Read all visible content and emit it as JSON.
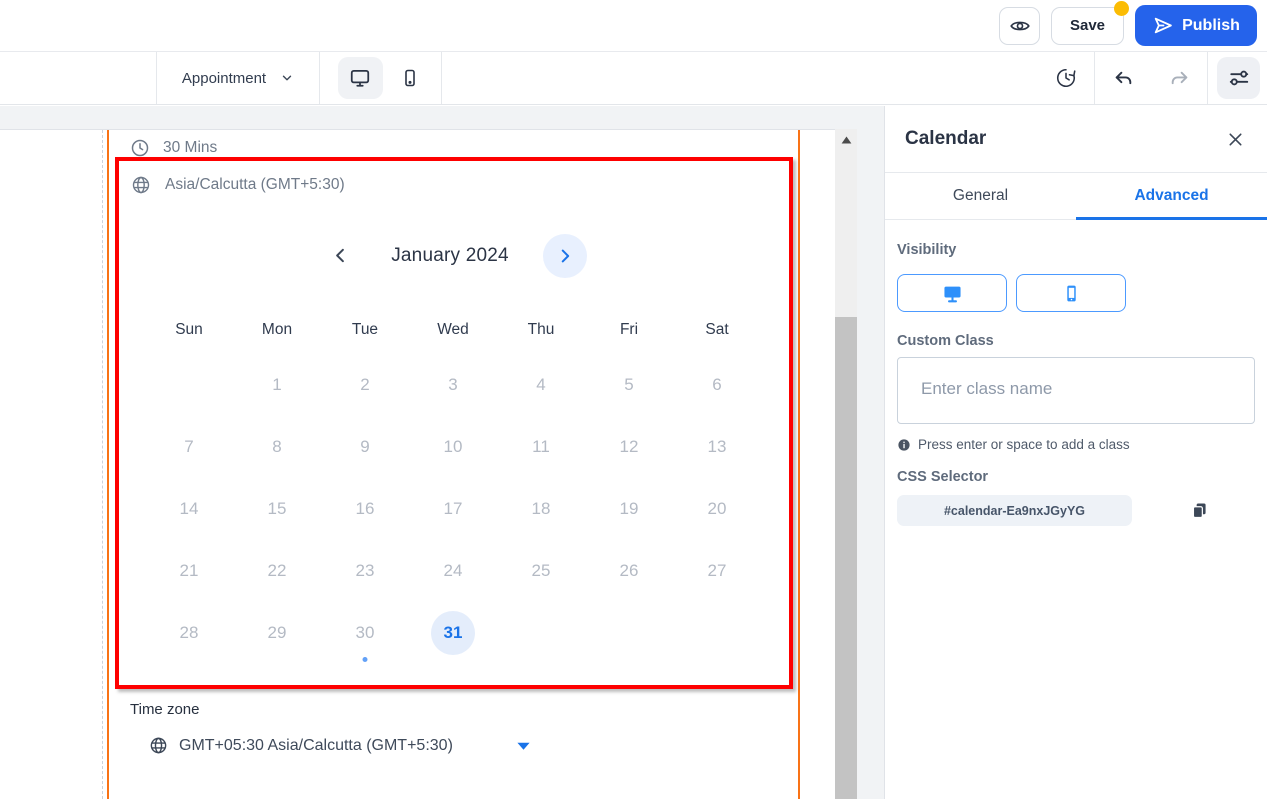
{
  "topbar": {
    "save_label": "Save",
    "publish_label": "Publish"
  },
  "toolbar": {
    "selected_page": "Appointment"
  },
  "panel": {
    "title": "Calendar",
    "tabs": {
      "general": "General",
      "advanced": "Advanced",
      "active_tab": "Advanced"
    },
    "visibility": {
      "label": "Visibility"
    },
    "custom_class": {
      "label": "Custom Class",
      "placeholder": "Enter class name",
      "value": "",
      "hint": "Press enter or space to add a class"
    },
    "css_selector": {
      "label": "CSS Selector",
      "value": "#calendar-Ea9nxJGyYG"
    }
  },
  "widget": {
    "duration": "30 Mins",
    "timezone_top": "Asia/Calcutta (GMT+5:30)",
    "calendar": {
      "month_label": "January 2024",
      "weekdays": [
        "Sun",
        "Mon",
        "Tue",
        "Wed",
        "Thu",
        "Fri",
        "Sat"
      ],
      "weeks": [
        [
          "",
          1,
          2,
          3,
          4,
          5,
          6
        ],
        [
          7,
          8,
          9,
          10,
          11,
          12,
          13
        ],
        [
          14,
          15,
          16,
          17,
          18,
          19,
          20
        ],
        [
          21,
          22,
          23,
          24,
          25,
          26,
          27
        ],
        [
          28,
          29,
          30,
          31,
          "",
          "",
          ""
        ]
      ],
      "selected_date": 31,
      "dotted_date": 30
    },
    "timezone_section": {
      "label": "Time zone",
      "value": "GMT+05:30 Asia/Calcutta (GMT+5:30)"
    }
  },
  "icons": {
    "eye-icon": "preview eye outline",
    "send-icon": "publish paper plane",
    "chevron-down-icon": "dropdown chevron",
    "monitor-icon": "desktop device",
    "smartphone-icon": "mobile device",
    "history-icon": "clock with restore arrow",
    "undo-icon": "undo arrow",
    "redo-icon": "redo arrow",
    "sliders-icon": "settings sliders",
    "close-icon": "close X",
    "clock-icon": "duration clock",
    "globe-icon": "timezone globe",
    "chevron-left-icon": "previous month",
    "chevron-right-icon": "next month",
    "caret-down-icon": "timezone select caret",
    "info-icon": "info filled circle",
    "copy-icon": "copy to clipboard",
    "scroll-up-icon": "scrollbar up arrow"
  },
  "colors": {
    "accent_blue": "#1a73e8",
    "publish_blue": "#2563eb",
    "selection_red": "#fe0000",
    "guide_orange": "#f97316",
    "badge_yellow": "#fbbc04",
    "selected_date_bg": "#e4edfb"
  }
}
